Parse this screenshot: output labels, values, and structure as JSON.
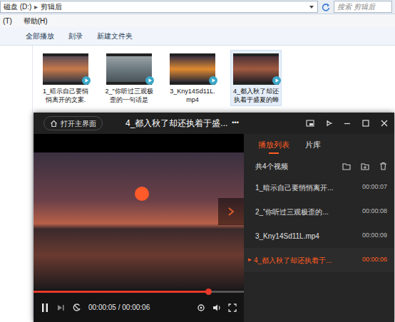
{
  "explorer": {
    "breadcrumb": [
      "磁盘 (D:)",
      "▸",
      "剪辑后"
    ],
    "search": {
      "placeholder": "搜索 剪辑后"
    },
    "menu": [
      "(T)",
      "帮助(H)"
    ],
    "toolbar": [
      "全部播放",
      "刻录",
      "新建文件夹"
    ],
    "files": [
      {
        "label": "1_暗示自己要悄悄离开的文案.",
        "selected": false
      },
      {
        "label": "2_\"你听过三观极歪的一句话是",
        "selected": false
      },
      {
        "label": "3_Kny14Sd11L.mp4",
        "selected": false
      },
      {
        "label": "4_都入秋了却还执着于盛夏的蝉",
        "selected": true
      }
    ]
  },
  "player": {
    "home_button": "打开主界面",
    "title": "4_都入秋了却还执着于盛...",
    "more": "•••",
    "progress": {
      "level": 0.83
    },
    "time": "00:00:05 / 00:00:06",
    "tabs": [
      {
        "label": "播放列表",
        "selected": true
      },
      {
        "label": "片库",
        "selected": false
      }
    ],
    "count": "共4个视频",
    "playing_icon": "▸",
    "playlist": [
      {
        "label": "1_暗示自己要悄悄离开...",
        "duration": "00:00:07",
        "playing": false
      },
      {
        "label": "2_“你听过三观极歪的...",
        "duration": "00:00:08",
        "playing": false
      },
      {
        "label": "3_Kny14Sd11L.mp4",
        "duration": "00:00:09",
        "playing": false
      },
      {
        "label": "4_都入秋了却还执着于...",
        "duration": "00:00:06",
        "playing": true
      }
    ]
  }
}
